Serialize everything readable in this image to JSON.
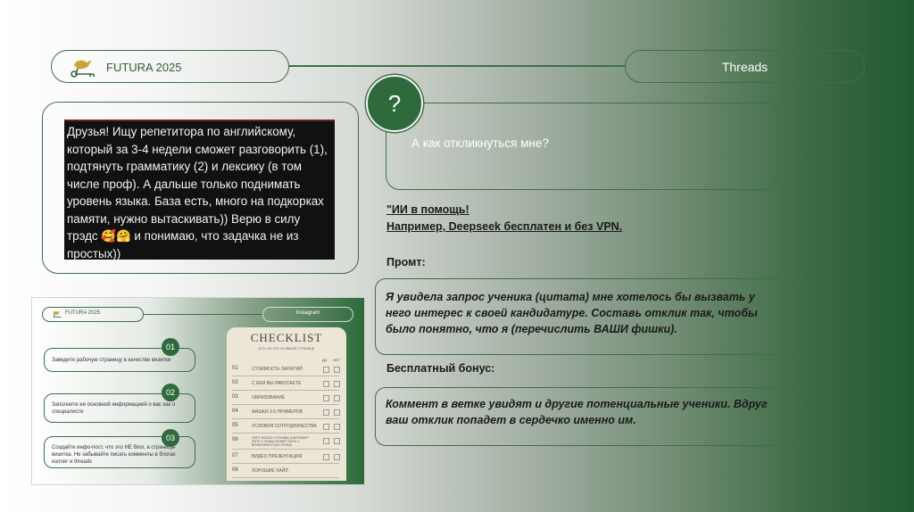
{
  "header": {
    "brand": "FUTURA 2025",
    "right_tab": "Threads"
  },
  "request_quote": {
    "text": "Друзья! Ищу репетитора по английскому, который за 3-4 недели сможет разговорить (1), подтянуть грамматику (2) и лексику (в том числе проф). А дальше только поднимать уровень языка. База есть, много на подкорках памяти, нужно вытаскивать)) Верю в силу трэдс 🥰🤗 и понимаю, что задачка не из простых))"
  },
  "question": {
    "icon_text": "?",
    "text": "А как откликнуться мне?"
  },
  "ai_help": {
    "line1": "\"ИИ в помощь!",
    "line2": "Например,  Deepseek бесплатен и без VPN."
  },
  "prompt": {
    "label": "Промт:",
    "text": "Я увидела запрос ученика (цитата) мне хотелось бы вызвать у него интерес к своей кандидатуре. Составь отклик так, чтобы было понятно, что я (перечислить ВАШИ фишки)."
  },
  "bonus": {
    "label": "Бесплатный бонус:",
    "text": "Коммент в ветке увидят и другие потенциальные ученики. Вдруг ваш отклик попадет в сердечко именно им."
  },
  "thumbnail": {
    "brand": "FUTURA 2025",
    "tab": "Instagram",
    "steps": [
      {
        "num": "01",
        "text": "Заведите рабочую страницу в качестве визитки"
      },
      {
        "num": "02",
        "text": "Заполните ее основной информацией о вас как о специалисте"
      },
      {
        "num": "03",
        "text": "Создайте инфо-пост, что это НЕ блог, а страница-визитка. Не забывайте писать комменты в блогах коллег и threads"
      }
    ],
    "checklist": {
      "title": "CHECKLIST",
      "subtitle": "ЕСТЬ ЛИ ЭТО НА ВАШЕЙ СТРАНИЦЕ",
      "col_yes": "ДА",
      "col_no": "НЕТ",
      "rows": [
        {
          "num": "01",
          "label": "СТОИМОСТЬ ЗАНЯТИЙ"
        },
        {
          "num": "02",
          "label": "С КЕМ ВЫ РАБОТАЕТЕ"
        },
        {
          "num": "03",
          "label": "ОБРАЗОВАНИЕ"
        },
        {
          "num": "04",
          "label": "ФИШКИ 3-5 ПРИМЕРОВ"
        },
        {
          "num": "05",
          "label": "УСЛОВИЯ СОТРУДНИЧЕСТВА"
        },
        {
          "num": "06",
          "label": "ПОРТ-ФОЛИО / ОТЗЫВЫ (НАПРИМЕР ФОТО 3 ЗНАКА МОЖЕТ БЫТЬ С ВОЗМОЖНОСТЬЮ УРОКА)"
        },
        {
          "num": "07",
          "label": "ВИДЕО ПРЕЗЕНТАЦИЯ"
        },
        {
          "num": "08",
          "label": "ХОРОШИЕ ХАЙЛ"
        }
      ]
    }
  }
}
